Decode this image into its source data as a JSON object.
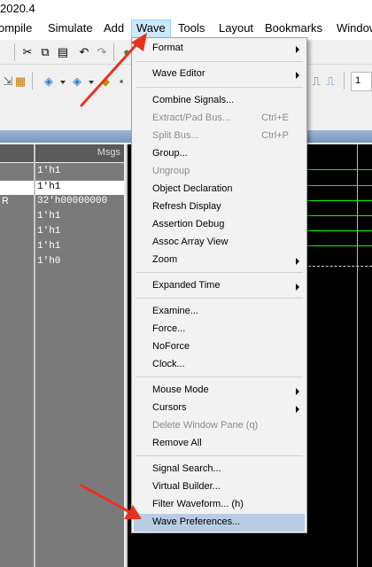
{
  "title": "2020.4",
  "menubar": {
    "items": [
      "ompile",
      "Simulate",
      "Add",
      "Wave",
      "Tools",
      "Layout",
      "Bookmarks",
      "Window"
    ],
    "active": "Wave"
  },
  "wave_window": {
    "msgs_header": "Msgs",
    "left_fragment": "R",
    "rows": [
      "1'h1",
      "1'h1",
      "32'h00000000",
      "1'h1",
      "1'h1",
      "1'h1",
      "1'h0"
    ],
    "selected_row_index": 1
  },
  "toolbar": {
    "input_fragment": "1"
  },
  "wave_menu": {
    "items": [
      {
        "label": "Format",
        "submenu": true
      },
      {
        "separator": true
      },
      {
        "label": "Wave Editor",
        "submenu": true
      },
      {
        "separator": true
      },
      {
        "label": "Combine Signals..."
      },
      {
        "label": "Extract/Pad Bus...",
        "shortcut": "Ctrl+E",
        "disabled": true
      },
      {
        "label": "Split Bus...",
        "shortcut": "Ctrl+P",
        "disabled": true
      },
      {
        "label": "Group..."
      },
      {
        "label": "Ungroup",
        "disabled": true
      },
      {
        "label": "Object Declaration"
      },
      {
        "label": "Refresh Display"
      },
      {
        "label": "Assertion Debug"
      },
      {
        "label": "Assoc Array View"
      },
      {
        "label": "Zoom",
        "submenu": true
      },
      {
        "separator": true
      },
      {
        "label": "Expanded Time",
        "submenu": true
      },
      {
        "separator": true
      },
      {
        "label": "Examine..."
      },
      {
        "label": "Force..."
      },
      {
        "label": "NoForce"
      },
      {
        "label": "Clock..."
      },
      {
        "separator": true
      },
      {
        "label": "Mouse Mode",
        "submenu": true
      },
      {
        "label": "Cursors",
        "submenu": true
      },
      {
        "label": "Delete Window Pane (q)",
        "disabled": true
      },
      {
        "label": "Remove All"
      },
      {
        "separator": true
      },
      {
        "label": "Signal Search..."
      },
      {
        "label": "Virtual Builder..."
      },
      {
        "label": "Filter Waveform... (h)"
      },
      {
        "label": "Wave Preferences...",
        "highlighted": true
      }
    ]
  },
  "colors": {
    "menu_highlight": "#b8cce4",
    "active_menu": "#cce8ff",
    "annotation_arrow": "#e8321e",
    "wave_background": "#000000",
    "signal_wave": "#00ff00"
  }
}
